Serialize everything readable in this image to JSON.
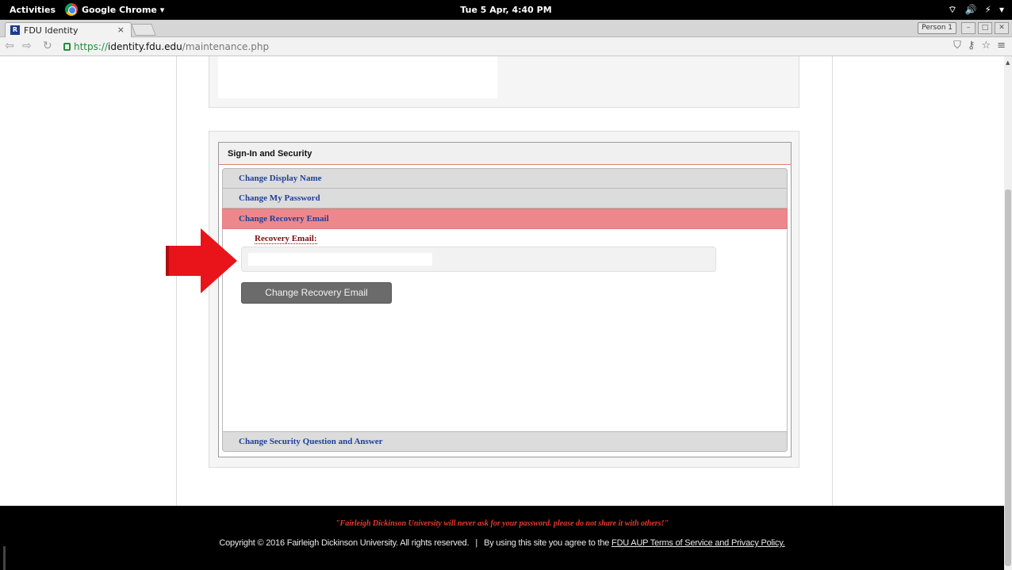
{
  "topbar": {
    "activities": "Activities",
    "app_name": "Google Chrome ▾",
    "clock": "Tue  5 Apr,  4:40 PM",
    "tray": [
      "⌔",
      "🔊",
      "⚡",
      "▾"
    ]
  },
  "browser": {
    "tab_title": "FDU Identity",
    "tab_close": "×",
    "favicon": "R",
    "profile": "Person 1",
    "url_scheme": "https://",
    "url_host": "identity.fdu.edu",
    "url_path": "/maintenance.php"
  },
  "icons": {
    "back": "⇦",
    "forward": "⇨",
    "reload": "↻",
    "star": "☆",
    "shield": "⛉",
    "key": "⚷",
    "menu": "≡",
    "minimize": "–",
    "maximize": "□",
    "close": "✕"
  },
  "security": {
    "header": "Sign-In and Security",
    "items": {
      "display_name": "Change Display Name",
      "password": "Change My Password",
      "recovery": "Change Recovery Email",
      "question": "Change Security Question and Answer"
    },
    "recovery_label": "Recovery Email:",
    "recovery_value": "",
    "button_label": "Change Recovery Email"
  },
  "footer": {
    "notice": "\"Fairleigh Dickinson University will never ask for your password. please do not share it with others!\"",
    "copyright": "Copyright © 2016 Fairleigh Dickinson University. All rights reserved.",
    "separator": "|",
    "agree_text": "By using this site you agree to the",
    "aup_link": "FDU AUP Terms of Service and Privacy Policy."
  },
  "colors": {
    "active_item": "#ec888c",
    "link_blue": "#1f3f9a",
    "arrow_red": "#e8141a",
    "footer_notice": "#e83a2d"
  }
}
